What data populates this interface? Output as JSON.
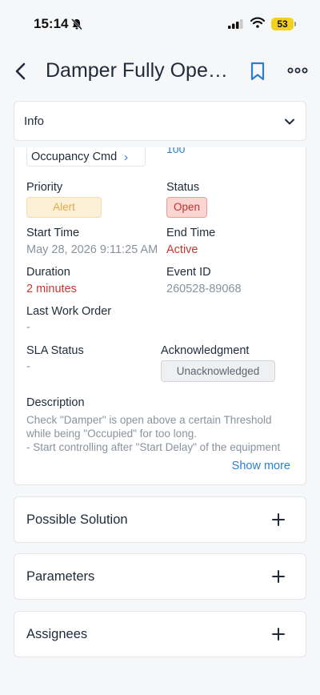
{
  "status_bar": {
    "time": "15:14",
    "battery": "53",
    "icons": [
      "bell-off-icon",
      "signal-icon",
      "wifi-icon",
      "battery-icon"
    ]
  },
  "nav": {
    "title": "Damper Fully Open Alarm",
    "icons": [
      "back-chevron-icon",
      "bookmark-icon",
      "more-horizontal-icon"
    ]
  },
  "info": {
    "header_label": "Info",
    "occupancy_button": "Occupancy Cmd",
    "partial_value": "100",
    "priority_label": "Priority",
    "priority_value": "Alert",
    "status_label": "Status",
    "status_value": "Open",
    "start_time_label": "Start Time",
    "start_time_value": "May 28, 2026 9:11:25 AM",
    "end_time_label": "End Time",
    "end_time_value": "Active",
    "duration_label": "Duration",
    "duration_value": "2 minutes",
    "event_id_label": "Event ID",
    "event_id_value": "260528-89068",
    "last_work_order_label": "Last Work Order",
    "last_work_order_value": "-",
    "sla_status_label": "SLA Status",
    "sla_status_value": "-",
    "acknowledgment_label": "Acknowledgment",
    "acknowledgment_value": "Unacknowledged",
    "description_label": "Description",
    "description_lines": [
      "Check \"Damper\" is open above a certain Threshold",
      "while being \"Occupied\" for too long.",
      "- Start controlling after \"Start Delay\" of the equipment"
    ],
    "show_more": "Show more"
  },
  "sections": [
    {
      "label": "Possible Solution"
    },
    {
      "label": "Parameters"
    },
    {
      "label": "Assignees"
    }
  ],
  "colors": {
    "accent": "#2a7fd4",
    "danger": "#c63631",
    "alert_text": "#e3a947",
    "alert_bg": "#fdf0d8",
    "open_bg": "#fbd5d2"
  }
}
